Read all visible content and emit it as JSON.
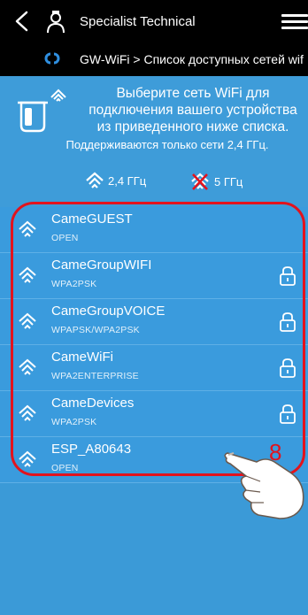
{
  "header": {
    "title": "Specialist Technical",
    "icons": [
      "back-arrow-icon",
      "user-icon",
      "menu-icon"
    ]
  },
  "breadcrumb": {
    "text": "GW-WiFi > Список доступных сетей wif",
    "icon": "link-icon"
  },
  "info": {
    "message": "Выберите сеть WiFi для подключения вашего устройства из приведенного ниже списка.",
    "note": "Поддерживаются только сети 2,4 ГГц.",
    "legend_24": "2,4 ГГц",
    "legend_5": "5 ГГц"
  },
  "networks": [
    {
      "name": "CameGUEST",
      "security": "OPEN",
      "locked": false
    },
    {
      "name": "CameGroupWIFI",
      "security": "WPA2PSK",
      "locked": true
    },
    {
      "name": "CameGroupVOICE",
      "security": "WPAPSK/WPA2PSK",
      "locked": true
    },
    {
      "name": "CameWiFi",
      "security": "WPA2ENTERPRISE",
      "locked": true
    },
    {
      "name": "CameDevices",
      "security": "WPA2PSK",
      "locked": true
    },
    {
      "name": "ESP_A80643",
      "security": "OPEN",
      "locked": false
    }
  ],
  "annotation": {
    "step_number": "8",
    "highlight_color": "#E2131D"
  },
  "colors": {
    "background": "#3B9AD7",
    "topbar": "#000000",
    "accent_link": "#2F8FE0"
  }
}
